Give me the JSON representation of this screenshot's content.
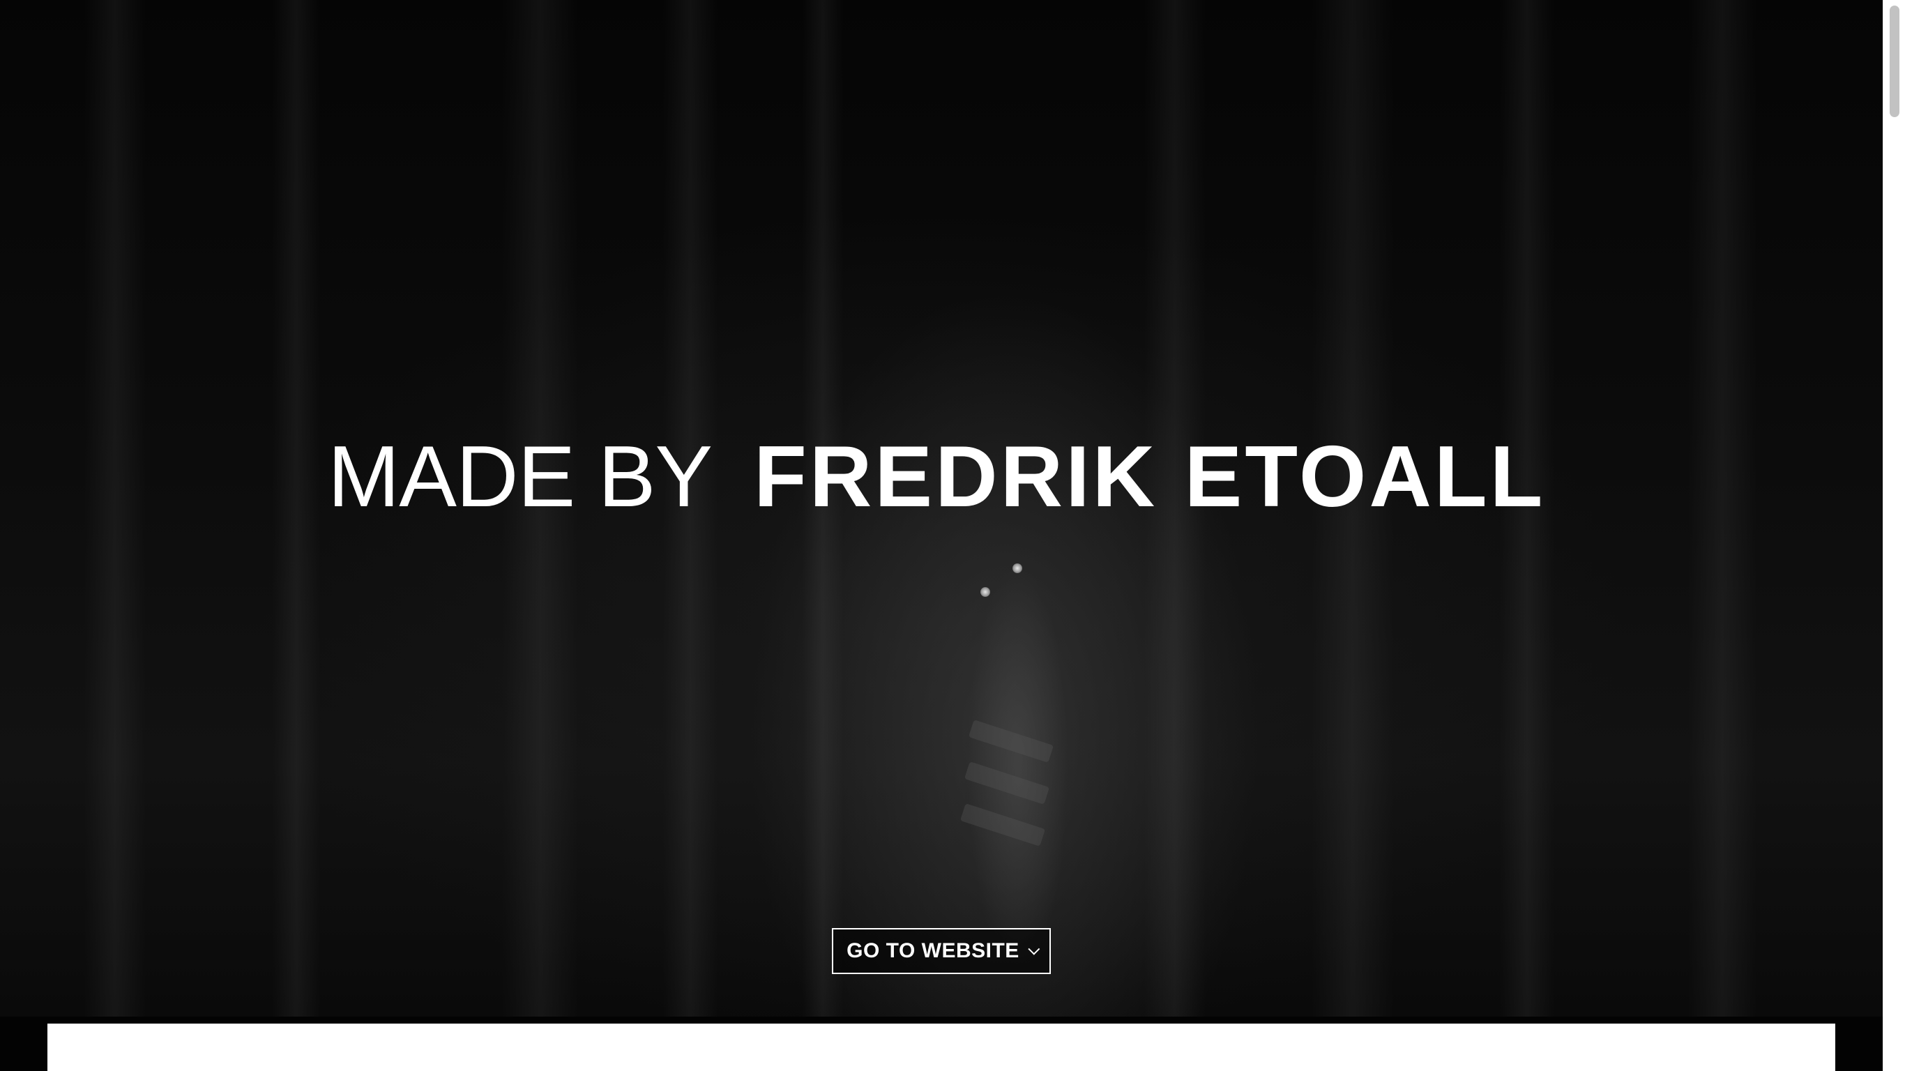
{
  "hero": {
    "headline_light": "MADE BY",
    "headline_bold": "FREDRIK ETOALL",
    "cta_label": "GO TO WEBSITE",
    "cta_icon": "chevron-down-icon",
    "background": "dark curtain video still with figure peeking through"
  },
  "colors": {
    "background": "#000000",
    "text": "#ffffff",
    "panel": "#ffffff",
    "scroll_thumb": "#c2c2c2"
  }
}
